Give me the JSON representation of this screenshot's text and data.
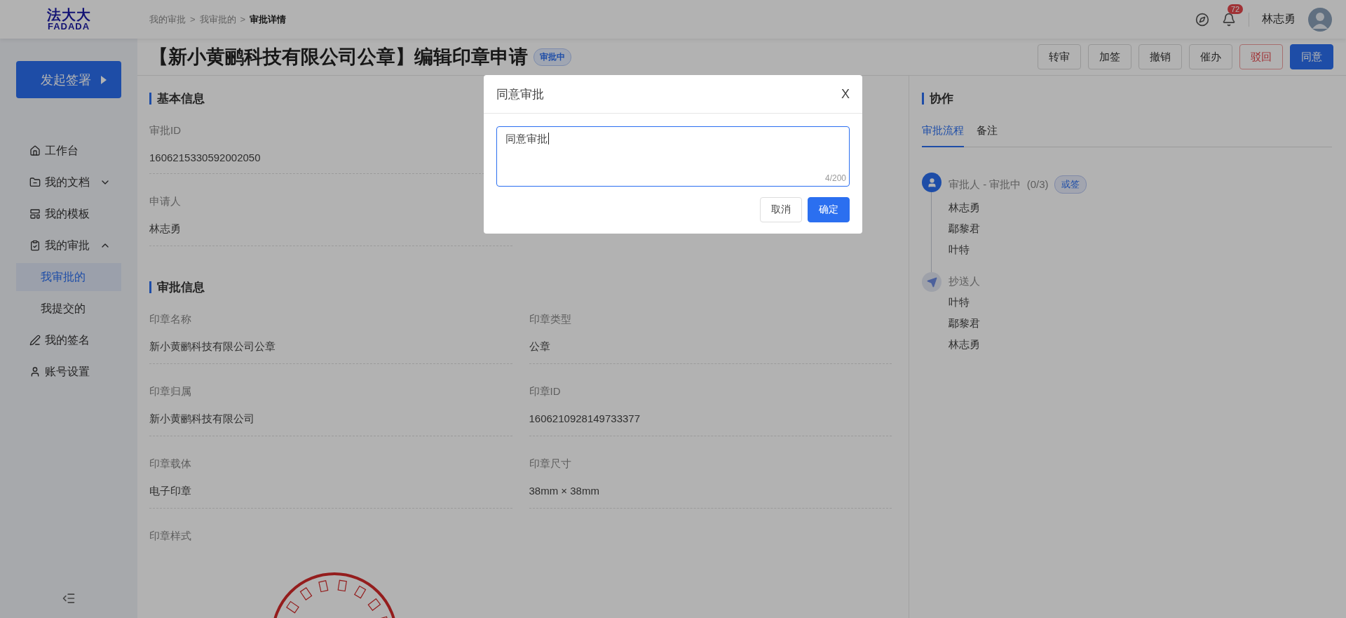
{
  "header": {
    "logo": {
      "top": "法大大",
      "bottom": "FADADA"
    },
    "breadcrumb": [
      {
        "label": "我的审批",
        "current": false
      },
      {
        "label": "我审批的",
        "current": false
      },
      {
        "label": "审批详情",
        "current": true
      }
    ],
    "separator": ">",
    "notification_count": "72",
    "user": "林志勇"
  },
  "sidebar": {
    "start_button": "发起签署",
    "items": [
      {
        "label": "工作台",
        "kind": "link",
        "selected": false
      },
      {
        "label": "我的文档",
        "kind": "group",
        "expanded": false,
        "selected": false
      },
      {
        "label": "我的模板",
        "kind": "link",
        "selected": false
      },
      {
        "label": "我的审批",
        "kind": "group",
        "expanded": true,
        "selected": false,
        "children": [
          {
            "label": "我审批的",
            "selected": true
          },
          {
            "label": "我提交的",
            "selected": false
          }
        ]
      },
      {
        "label": "我的签名",
        "kind": "link",
        "selected": false
      },
      {
        "label": "账号设置",
        "kind": "link",
        "selected": false
      }
    ]
  },
  "page": {
    "title": "【新小黄鹂科技有限公司公章】编辑印章申请",
    "status": "审批中",
    "actions": [
      {
        "label": "转审",
        "kind": "default"
      },
      {
        "label": "加签",
        "kind": "default"
      },
      {
        "label": "撤销",
        "kind": "default"
      },
      {
        "label": "催办",
        "kind": "default"
      },
      {
        "label": "驳回",
        "kind": "danger"
      },
      {
        "label": "同意",
        "kind": "primary"
      }
    ]
  },
  "sections": [
    {
      "title": "基本信息",
      "fields": [
        {
          "label": "审批ID",
          "kind": "text",
          "value": "1606215330592002050"
        },
        {
          "label": "申请人",
          "kind": "text",
          "value": "林志勇"
        }
      ]
    },
    {
      "title": "审批信息",
      "fields": [
        {
          "label": "印章名称",
          "kind": "text",
          "value": "新小黄鹂科技有限公司公章"
        },
        {
          "label": "印章类型",
          "kind": "text",
          "value": "公章"
        },
        {
          "label": "印章归属",
          "kind": "text",
          "value": "新小黄鹂科技有限公司"
        },
        {
          "label": "印章ID",
          "kind": "text",
          "value": "1606210928149733377"
        },
        {
          "label": "印章载体",
          "kind": "text",
          "value": "电子印章"
        },
        {
          "label": "印章尺寸",
          "kind": "text",
          "value": "38mm × 38mm"
        },
        {
          "label": "印章样式",
          "kind": "picture"
        }
      ]
    }
  ],
  "collaboration": {
    "title": "协作",
    "tabs": [
      {
        "label": "审批流程",
        "selected": true
      },
      {
        "label": "备注",
        "selected": false
      }
    ],
    "steps": [
      {
        "kind": "approver",
        "title": "审批人 - 审批中  (0/3)",
        "tag": "或签",
        "people": [
          "林志勇",
          "鄢黎君",
          "叶特"
        ]
      },
      {
        "kind": "cc",
        "title": "抄送人",
        "people": [
          "叶特",
          "鄢黎君",
          "林志勇"
        ]
      }
    ]
  },
  "dialog": {
    "title": "同意审批",
    "close": "X",
    "comment": {
      "value": "同意审批",
      "counter": "4/200"
    },
    "buttons": [
      {
        "label": "取消",
        "kind": "default"
      },
      {
        "label": "确定",
        "kind": "primary"
      }
    ]
  }
}
